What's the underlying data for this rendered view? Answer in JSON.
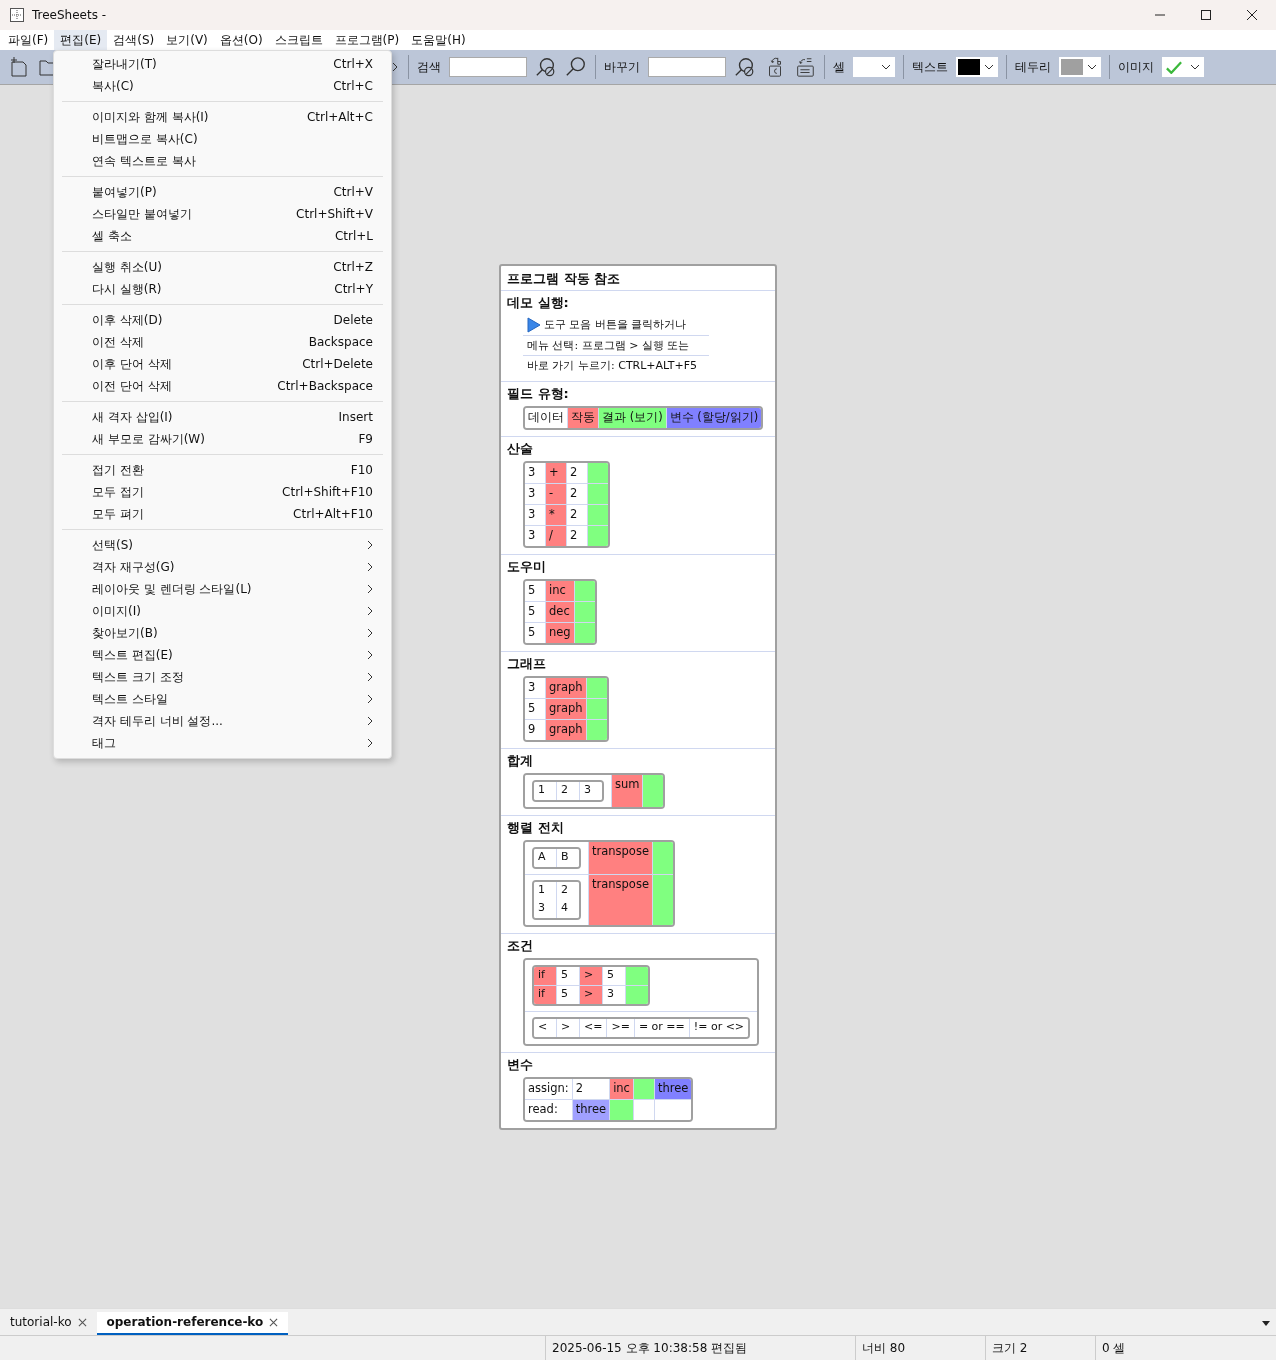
{
  "window": {
    "title": "TreeSheets -"
  },
  "menubar": [
    {
      "label": "파일(F)",
      "selected": false
    },
    {
      "label": "편집(E)",
      "selected": true
    },
    {
      "label": "검색(S)",
      "selected": false
    },
    {
      "label": "보기(V)",
      "selected": false
    },
    {
      "label": "옵션(O)",
      "selected": false
    },
    {
      "label": "스크립트",
      "selected": false
    },
    {
      "label": "프로그램(P)",
      "selected": false
    },
    {
      "label": "도움말(H)",
      "selected": false
    }
  ],
  "toolbar": {
    "search_label": "검색",
    "replace_label": "바꾸기",
    "pickers": [
      {
        "label": "셀",
        "kind": "blank"
      },
      {
        "label": "텍스트",
        "kind": "swatch",
        "color": "#000000"
      },
      {
        "label": "테두리",
        "kind": "swatch",
        "color": "#a0a0a0"
      },
      {
        "label": "이미지",
        "kind": "check"
      }
    ]
  },
  "edit_menu": [
    [
      {
        "label": "잘라내기(T)",
        "shortcut": "Ctrl+X",
        "kind": "command"
      },
      {
        "label": "복사(C)",
        "shortcut": "Ctrl+C",
        "kind": "command"
      }
    ],
    [
      {
        "label": "이미지와 함께 복사(I)",
        "shortcut": "Ctrl+Alt+C",
        "kind": "command"
      },
      {
        "label": "비트맵으로 복사(C)",
        "kind": "command"
      },
      {
        "label": "연속 텍스트로 복사",
        "kind": "command"
      }
    ],
    [
      {
        "label": "붙여넣기(P)",
        "shortcut": "Ctrl+V",
        "kind": "command"
      },
      {
        "label": "스타일만 붙여넣기",
        "shortcut": "Ctrl+Shift+V",
        "kind": "command"
      },
      {
        "label": "셀 축소",
        "shortcut": "Ctrl+L",
        "kind": "command"
      }
    ],
    [
      {
        "label": "실행 취소(U)",
        "shortcut": "Ctrl+Z",
        "kind": "command"
      },
      {
        "label": "다시 실행(R)",
        "shortcut": "Ctrl+Y",
        "kind": "command"
      }
    ],
    [
      {
        "label": "이후 삭제(D)",
        "shortcut": "Delete",
        "kind": "command"
      },
      {
        "label": "이전 삭제",
        "shortcut": "Backspace",
        "kind": "command"
      },
      {
        "label": "이후 단어 삭제",
        "shortcut": "Ctrl+Delete",
        "kind": "command"
      },
      {
        "label": "이전 단어 삭제",
        "shortcut": "Ctrl+Backspace",
        "kind": "command"
      }
    ],
    [
      {
        "label": "새 격자 삽입(I)",
        "shortcut": "Insert",
        "kind": "command"
      },
      {
        "label": "새 부모로 감싸기(W)",
        "shortcut": "F9",
        "kind": "command"
      }
    ],
    [
      {
        "label": "접기 전환",
        "shortcut": "F10",
        "kind": "command"
      },
      {
        "label": "모두 접기",
        "shortcut": "Ctrl+Shift+F10",
        "kind": "command"
      },
      {
        "label": "모두 펴기",
        "shortcut": "Ctrl+Alt+F10",
        "kind": "command"
      }
    ],
    [
      {
        "label": "선택(S)",
        "kind": "submenu"
      },
      {
        "label": "격자 재구성(G)",
        "kind": "submenu"
      },
      {
        "label": "레이아웃 및 렌더링 스타일(L)",
        "kind": "submenu"
      },
      {
        "label": "이미지(I)",
        "kind": "submenu"
      },
      {
        "label": "찾아보기(B)",
        "kind": "submenu"
      },
      {
        "label": "텍스트 편집(E)",
        "kind": "submenu"
      },
      {
        "label": "텍스트 크기 조정",
        "kind": "submenu"
      },
      {
        "label": "텍스트 스타일",
        "kind": "submenu"
      },
      {
        "label": "격자 테두리 너비 설정...",
        "kind": "submenu"
      },
      {
        "label": "태그",
        "kind": "submenu"
      }
    ]
  ],
  "document": {
    "title": "프로그램 작동 참조",
    "sections": [
      {
        "title": "데모 실행:",
        "lines": [
          {
            "text": "도구 모음 버튼을 클릭하거나",
            "kind": "run"
          },
          {
            "text": "메뉴 선택: 프로그램 > 실행 또는",
            "kind": "plain"
          },
          {
            "text": "바로 가기 누르기: CTRL+ALT+F5",
            "kind": "plain"
          }
        ]
      },
      {
        "title": "필드 유형:",
        "grid": [
          [
            {
              "kind": "data",
              "text": "데이터"
            },
            {
              "kind": "op",
              "text": "작동"
            },
            {
              "kind": "result",
              "text": "결과 (보기)"
            },
            {
              "kind": "var",
              "text": "변수 (할당/읽기)"
            }
          ]
        ]
      },
      {
        "title": "산술",
        "grid": [
          [
            {
              "kind": "data",
              "text": "3"
            },
            {
              "kind": "op",
              "text": "+"
            },
            {
              "kind": "data",
              "text": "2"
            },
            {
              "kind": "result"
            }
          ],
          [
            {
              "kind": "data",
              "text": "3"
            },
            {
              "kind": "op",
              "text": "-"
            },
            {
              "kind": "data",
              "text": "2"
            },
            {
              "kind": "result"
            }
          ],
          [
            {
              "kind": "data",
              "text": "3"
            },
            {
              "kind": "op",
              "text": "*"
            },
            {
              "kind": "data",
              "text": "2"
            },
            {
              "kind": "result"
            }
          ],
          [
            {
              "kind": "data",
              "text": "3"
            },
            {
              "kind": "op",
              "text": "/"
            },
            {
              "kind": "data",
              "text": "2"
            },
            {
              "kind": "result"
            }
          ]
        ]
      },
      {
        "title": "도우미",
        "grid": [
          [
            {
              "kind": "data",
              "text": "5"
            },
            {
              "kind": "op",
              "text": "inc"
            },
            {
              "kind": "result"
            }
          ],
          [
            {
              "kind": "data",
              "text": "5"
            },
            {
              "kind": "op",
              "text": "dec"
            },
            {
              "kind": "result"
            }
          ],
          [
            {
              "kind": "data",
              "text": "5"
            },
            {
              "kind": "op",
              "text": "neg"
            },
            {
              "kind": "result"
            }
          ]
        ]
      },
      {
        "title": "그래프",
        "grid": [
          [
            {
              "kind": "data",
              "text": "3"
            },
            {
              "kind": "op",
              "text": "graph"
            },
            {
              "kind": "result"
            }
          ],
          [
            {
              "kind": "data",
              "text": "5"
            },
            {
              "kind": "op",
              "text": "graph"
            },
            {
              "kind": "result"
            }
          ],
          [
            {
              "kind": "data",
              "text": "9"
            },
            {
              "kind": "op",
              "text": "graph"
            },
            {
              "kind": "result"
            }
          ]
        ]
      },
      {
        "title": "합계",
        "grid": [
          [
            {
              "kind": "data",
              "grid": [
                [
                  {
                    "kind": "data",
                    "text": "1"
                  },
                  {
                    "kind": "data",
                    "text": "2"
                  },
                  {
                    "kind": "data",
                    "text": "3"
                  }
                ]
              ]
            },
            {
              "kind": "op",
              "text": "sum"
            },
            {
              "kind": "result"
            }
          ]
        ]
      },
      {
        "title": "행렬 전치",
        "grid": [
          [
            {
              "kind": "data",
              "grid": [
                [
                  {
                    "kind": "data",
                    "text": "A"
                  },
                  {
                    "kind": "data",
                    "text": "B"
                  }
                ]
              ]
            },
            {
              "kind": "op",
              "text": "transpose"
            },
            {
              "kind": "result"
            }
          ],
          [
            {
              "kind": "data",
              "grid": [
                [
                  {
                    "kind": "data",
                    "text": "1"
                  },
                  {
                    "kind": "data",
                    "text": "2"
                  }
                ],
                [
                  {
                    "kind": "data",
                    "text": "3"
                  },
                  {
                    "kind": "data",
                    "text": "4"
                  }
                ]
              ]
            },
            {
              "kind": "op",
              "text": "transpose"
            },
            {
              "kind": "result"
            }
          ]
        ]
      },
      {
        "title": "조건",
        "grid": [
          [
            {
              "kind": "data",
              "grid": [
                [
                  {
                    "kind": "op",
                    "text": "if"
                  },
                  {
                    "kind": "data",
                    "text": "5"
                  },
                  {
                    "kind": "op",
                    "text": ">"
                  },
                  {
                    "kind": "data",
                    "text": "5"
                  },
                  {
                    "kind": "result"
                  }
                ],
                [
                  {
                    "kind": "op",
                    "text": "if"
                  },
                  {
                    "kind": "data",
                    "text": "5"
                  },
                  {
                    "kind": "op",
                    "text": ">"
                  },
                  {
                    "kind": "data",
                    "text": "3"
                  },
                  {
                    "kind": "result"
                  }
                ]
              ]
            }
          ],
          [
            {
              "kind": "data",
              "grid": [
                [
                  {
                    "kind": "data",
                    "text": "<"
                  },
                  {
                    "kind": "data",
                    "text": ">"
                  },
                  {
                    "kind": "data",
                    "text": "<="
                  },
                  {
                    "kind": "data",
                    "text": ">="
                  },
                  {
                    "kind": "data",
                    "text": "= or =="
                  },
                  {
                    "kind": "data",
                    "text": "!= or <>"
                  }
                ]
              ]
            }
          ]
        ]
      },
      {
        "title": "변수",
        "grid": [
          [
            {
              "kind": "data",
              "text": "assign:"
            },
            {
              "kind": "data",
              "text": "2"
            },
            {
              "kind": "op",
              "text": "inc"
            },
            {
              "kind": "result"
            },
            {
              "kind": "var",
              "text": "three"
            }
          ],
          [
            {
              "kind": "data",
              "text": "read:"
            },
            {
              "kind": "read",
              "text": "three"
            },
            {
              "kind": "result"
            },
            {
              "kind": "data"
            },
            {
              "kind": "data"
            }
          ]
        ]
      }
    ]
  },
  "tabs": [
    {
      "label": "tutorial-ko",
      "selected": false
    },
    {
      "label": "operation-reference-ko",
      "selected": true
    }
  ],
  "status_bar": [
    "2025-06-15 오후 10:38:58 편집됨",
    "너비 80",
    "크기 2",
    "0 셀"
  ]
}
